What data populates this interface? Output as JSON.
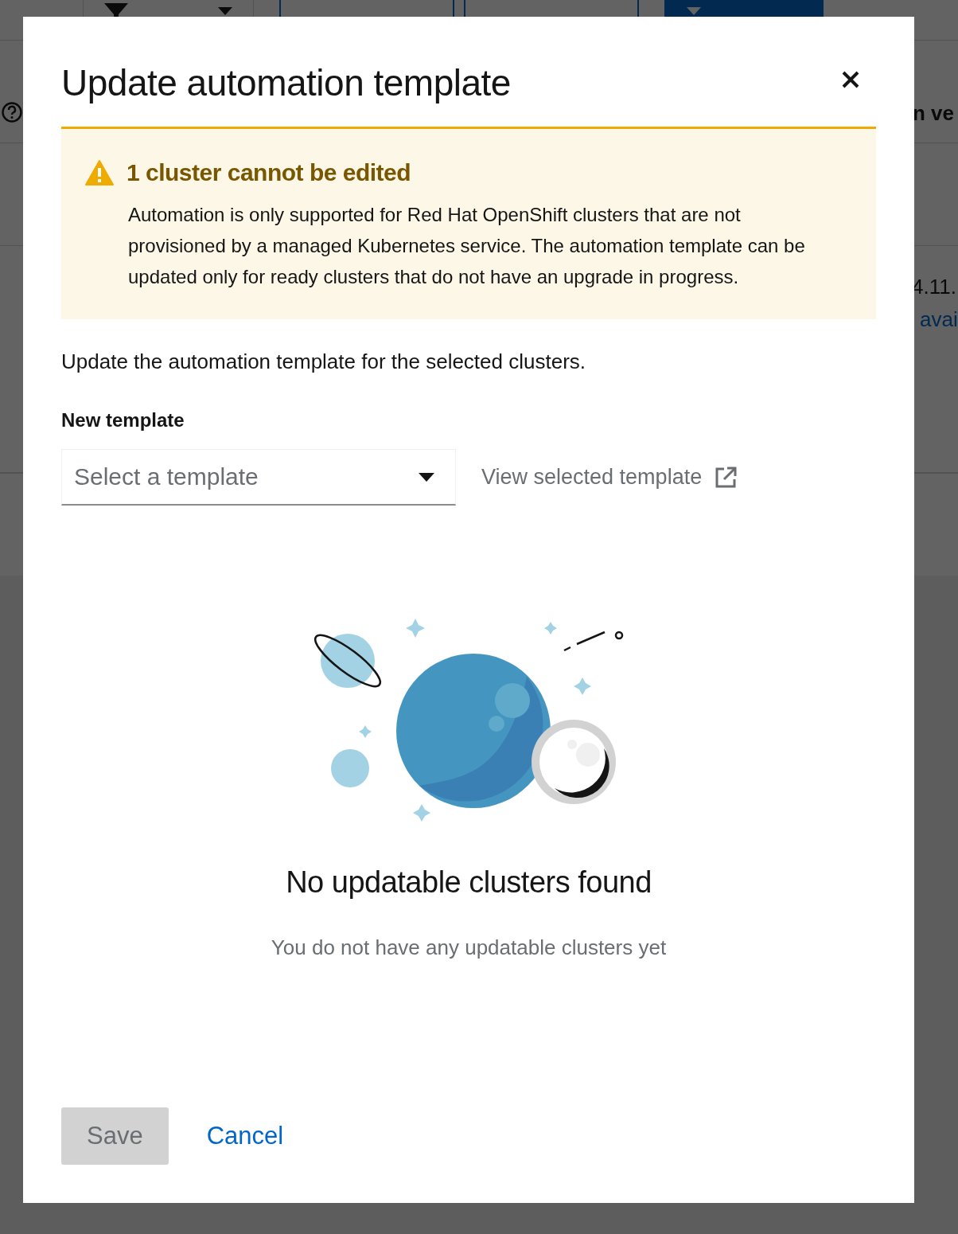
{
  "background": {
    "toolbar": [
      {
        "kind": "filter"
      },
      {
        "kind": "secondary"
      },
      {
        "kind": "secondary"
      },
      {
        "kind": "primary"
      }
    ],
    "column_header": "n ve",
    "version": "4.11.",
    "link": "avai"
  },
  "modal": {
    "title": "Update automation template",
    "alert": {
      "title": "1 cluster cannot be edited",
      "body": "Automation is only supported for Red Hat OpenShift clusters that are not provisioned by a managed Kubernetes service. The automation template can be updated only for ready clusters that do not have an upgrade in progress."
    },
    "description": "Update the automation template for the selected clusters.",
    "field_label": "New template",
    "select": {
      "placeholder": "Select a template"
    },
    "view_link": "View selected template",
    "empty_state": {
      "title": "No updatable clusters found",
      "body": "You do not have any updatable clusters yet"
    },
    "buttons": [
      {
        "kind": "primary",
        "label": "Save",
        "disabled": true
      },
      {
        "kind": "link",
        "label": "Cancel",
        "disabled": false
      }
    ]
  }
}
